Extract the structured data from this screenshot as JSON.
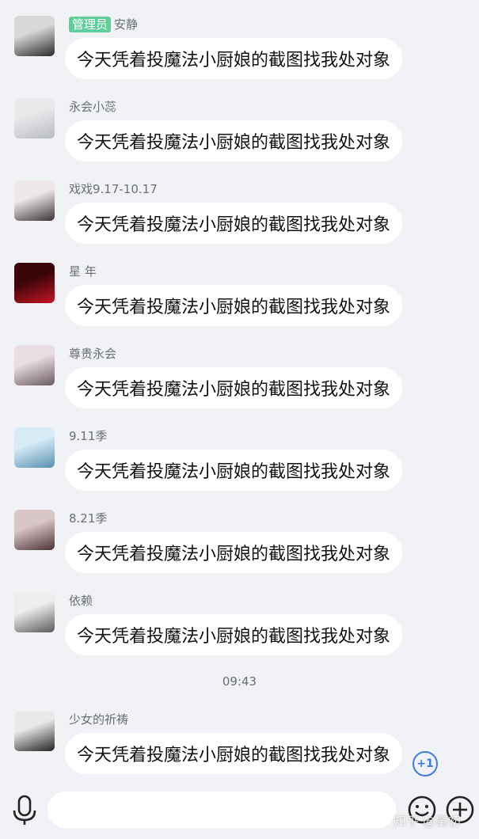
{
  "messages": [
    {
      "badge": "管理员",
      "nick": "安静",
      "text": "今天凭着投魔法小厨娘的截图找我处对象",
      "avatar_colors": [
        "#d8d8d8",
        "#2a2a2a"
      ]
    },
    {
      "badge": "",
      "nick": "永会小蕊",
      "text": "今天凭着投魔法小厨娘的截图找我处对象",
      "avatar_colors": [
        "#e8e8ea",
        "#b9bcc2"
      ]
    },
    {
      "badge": "",
      "nick": "戏戏9.17-10.17",
      "text": "今天凭着投魔法小厨娘的截图找我处对象",
      "avatar_colors": [
        "#eee8ea",
        "#3b3335"
      ]
    },
    {
      "badge": "",
      "nick": "星 年",
      "text": "今天凭着投魔法小厨娘的截图找我处对象",
      "avatar_colors": [
        "#3a0509",
        "#c41624"
      ]
    },
    {
      "badge": "",
      "nick": "尊贵永会",
      "text": "今天凭着投魔法小厨娘的截图找我处对象",
      "avatar_colors": [
        "#e7dde2",
        "#6a5a60"
      ]
    },
    {
      "badge": "",
      "nick": "9.11季",
      "text": "今天凭着投魔法小厨娘的截图找我处对象",
      "avatar_colors": [
        "#d7ecf6",
        "#5a8fb1"
      ]
    },
    {
      "badge": "",
      "nick": "8.21季",
      "text": "今天凭着投魔法小厨娘的截图找我处对象",
      "avatar_colors": [
        "#d9c6c9",
        "#4a3336"
      ]
    },
    {
      "badge": "",
      "nick": "依赖",
      "text": "今天凭着投魔法小厨娘的截图找我处对象",
      "avatar_colors": [
        "#eeeeee",
        "#5a5a5a"
      ]
    },
    {
      "badge": "",
      "nick": "少女的祈祷",
      "text": "今天凭着投魔法小厨娘的截图找我处对象",
      "avatar_colors": [
        "#e9e9e9",
        "#222222"
      ]
    }
  ],
  "timestamp": "09:43",
  "unread_badge": "+1",
  "input": {
    "placeholder": ""
  },
  "icons": {
    "mic": "microphone-icon",
    "emoji": "emoji-icon",
    "add": "add-icon"
  },
  "watermark": "知乎 @肇初",
  "colors": {
    "background": "#f0f2f5",
    "bubble": "#ffffff",
    "admin_badge": "#5fcf9a",
    "accent": "#3d7de0"
  }
}
